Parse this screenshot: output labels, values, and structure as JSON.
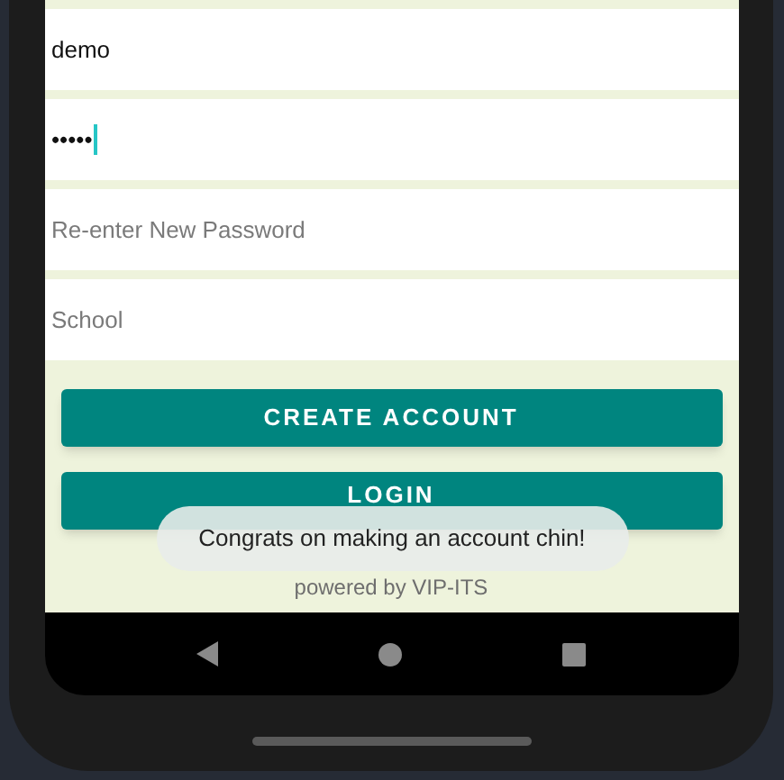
{
  "fields": [
    {
      "kind": "value",
      "text": "demo",
      "focused": false
    },
    {
      "kind": "value",
      "text": "•••••",
      "focused": true
    },
    {
      "kind": "placeholder",
      "text": "Re-enter New Password",
      "focused": false
    },
    {
      "kind": "placeholder",
      "text": "School",
      "focused": false
    }
  ],
  "buttons": [
    "CREATE ACCOUNT",
    "LOGIN"
  ],
  "toast": "Congrats on making an account chin!",
  "footer": "powered by VIP-ITS"
}
